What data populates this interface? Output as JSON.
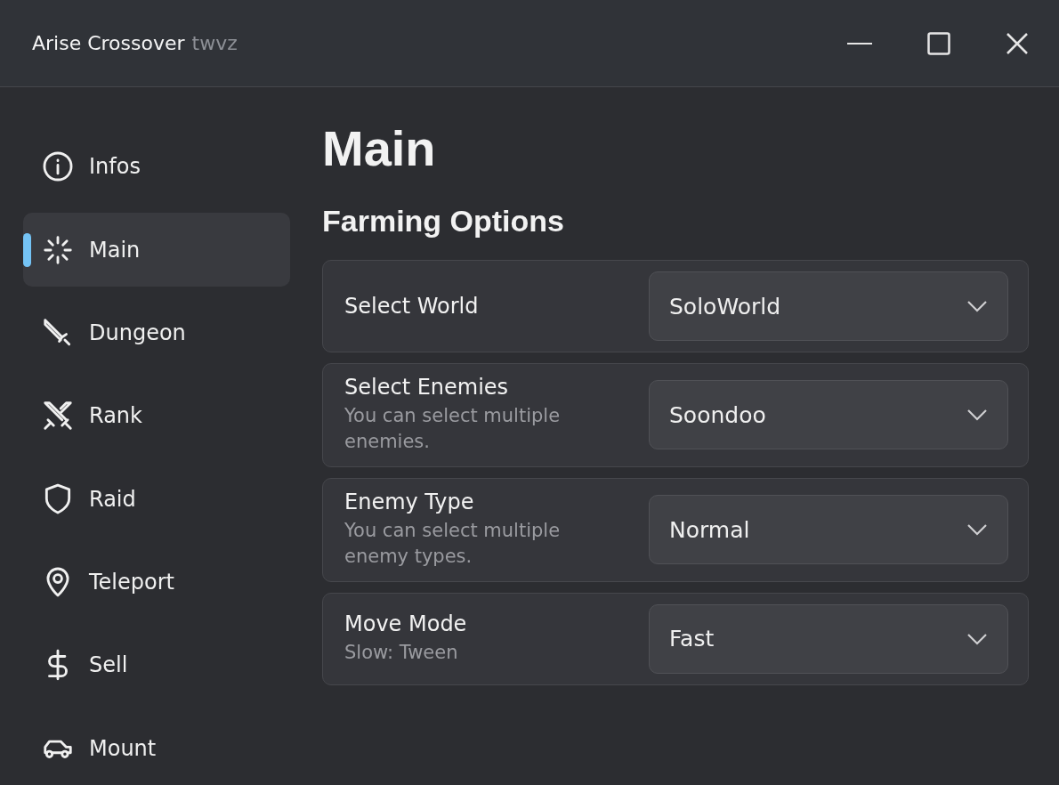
{
  "window": {
    "title": "Arise Crossover",
    "subtitle": "twvz"
  },
  "sidebar": {
    "items": [
      {
        "label": "Infos",
        "selected": false
      },
      {
        "label": "Main",
        "selected": true
      },
      {
        "label": "Dungeon",
        "selected": false
      },
      {
        "label": "Rank",
        "selected": false
      },
      {
        "label": "Raid",
        "selected": false
      },
      {
        "label": "Teleport",
        "selected": false
      },
      {
        "label": "Sell",
        "selected": false
      },
      {
        "label": "Mount",
        "selected": false
      }
    ]
  },
  "page": {
    "title": "Main",
    "section": "Farming Options",
    "options": [
      {
        "label": "Select World",
        "value": "SoloWorld"
      },
      {
        "label": "Select Enemies",
        "description": "You can select multiple enemies.",
        "value": "Soondoo"
      },
      {
        "label": "Enemy Type",
        "description": "You can select multiple enemy types.",
        "value": "Normal"
      },
      {
        "label": "Move Mode",
        "description": "Slow: Tween",
        "value": "Fast"
      }
    ]
  }
}
